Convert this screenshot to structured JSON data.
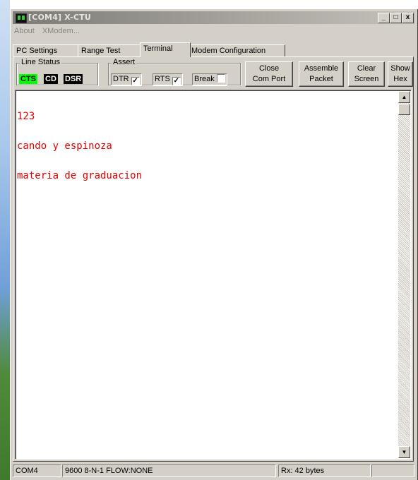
{
  "window": {
    "title": "[COM4] X-CTU",
    "min_glyph": "_",
    "max_glyph": "□",
    "close_glyph": "x"
  },
  "menu": [
    "About",
    "XModem..."
  ],
  "tabs": [
    "PC Settings",
    "Range Test",
    "Terminal",
    "Modem Configuration"
  ],
  "line_status": {
    "label": "Line Status",
    "leds": [
      {
        "label": "CTS",
        "bg": "#00ff00",
        "fg": "#000000"
      },
      {
        "label": "CD",
        "bg": "#000000",
        "fg": "#ffffff"
      },
      {
        "label": "DSR",
        "bg": "#000000",
        "fg": "#ffffff"
      }
    ]
  },
  "assert": {
    "label": "Assert",
    "items": [
      {
        "label": "DTR",
        "checked": true
      },
      {
        "label": "RTS",
        "checked": true
      },
      {
        "label": "Break",
        "checked": false
      }
    ]
  },
  "buttons": [
    {
      "line1": "Close",
      "line2": "Com Port"
    },
    {
      "line1": "Assemble",
      "line2": "Packet"
    },
    {
      "line1": "Clear",
      "line2": "Screen"
    },
    {
      "line1": "Show",
      "line2": "Hex"
    }
  ],
  "terminal": {
    "lines": [
      "123",
      "cando y espinoza",
      "materia de graduacion"
    ],
    "text_color": "#e60000"
  },
  "status": {
    "port": "COM4",
    "settings": "9600 8-N-1  FLOW:NONE",
    "rx": "Rx: 42 bytes"
  }
}
